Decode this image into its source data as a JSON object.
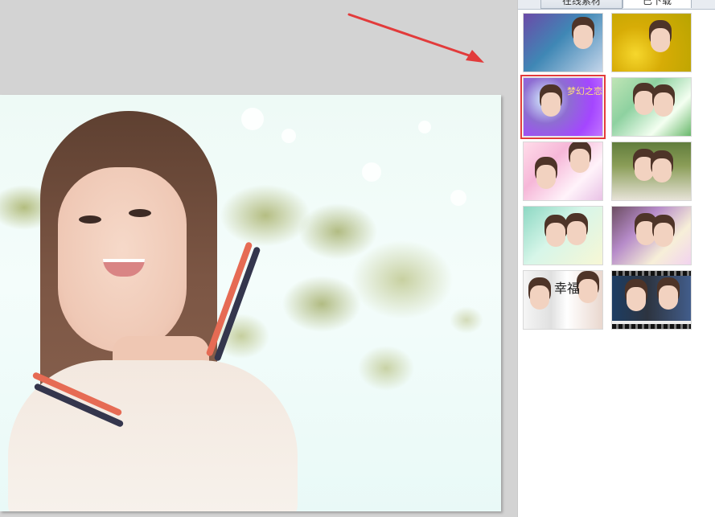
{
  "panel": {
    "tabs": [
      {
        "label": "在线素材",
        "active": false
      },
      {
        "label": "已下载",
        "active": true
      }
    ]
  },
  "thumbnails": [
    {
      "id": "thumb-1",
      "theme": "blue-purple-floral-portrait",
      "selected": false
    },
    {
      "id": "thumb-2",
      "theme": "yellow-floral-portrait",
      "selected": false
    },
    {
      "id": "thumb-3",
      "theme": "purple-bubble-template",
      "selected": true,
      "caption": "梦幻之恋"
    },
    {
      "id": "thumb-4",
      "theme": "green-wedding-couple",
      "selected": false
    },
    {
      "id": "thumb-5",
      "theme": "pink-heart-portraits",
      "selected": false
    },
    {
      "id": "thumb-6",
      "theme": "outdoor-wedding-couple",
      "selected": false
    },
    {
      "id": "thumb-7",
      "theme": "mint-wedding-couple",
      "selected": false
    },
    {
      "id": "thumb-8",
      "theme": "lavender-wedding-couple",
      "selected": false
    },
    {
      "id": "thumb-9",
      "theme": "black-white-portrait-fortune",
      "selected": false,
      "caption": "幸福"
    },
    {
      "id": "thumb-10",
      "theme": "film-strip-couple",
      "selected": false
    }
  ],
  "colors": {
    "workspace_bg": "#d3d3d3",
    "panel_bg": "#ffffff",
    "selection_red": "#e23b3b",
    "arrow_red": "#e23b3b"
  }
}
